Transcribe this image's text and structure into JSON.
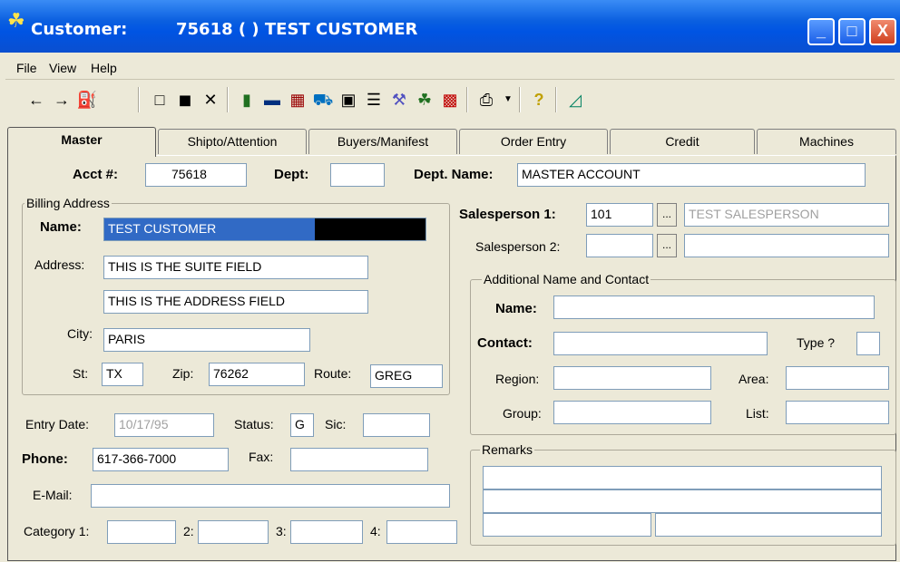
{
  "window": {
    "title": "Customer:",
    "title_acct": "75618 (   ) TEST CUSTOMER",
    "minimize_glyph": "_",
    "maximize_glyph": "□",
    "close_glyph": "X"
  },
  "menu": {
    "file": "File",
    "view": "View",
    "help": "Help"
  },
  "toolbar": {
    "icons": [
      "back-arrow-icon",
      "forward-arrow-icon",
      "binoculars-icon",
      "new-document-icon",
      "save-disk-icon",
      "delete-x-icon",
      "book-icon",
      "ruler-icon",
      "calendar-icon",
      "truck-icon",
      "open-book-icon",
      "hierarchy-icon",
      "tools-icon",
      "handshake-icon",
      "report-icon",
      "print-icon",
      "dropdown-arrow-icon",
      "help-question-icon",
      "exit-door-icon"
    ]
  },
  "tabs": [
    {
      "label": "Master",
      "active": true
    },
    {
      "label": "Shipto/Attention",
      "active": false
    },
    {
      "label": "Buyers/Manifest",
      "active": false
    },
    {
      "label": "Order Entry",
      "active": false
    },
    {
      "label": "Credit",
      "active": false
    },
    {
      "label": "Machines",
      "active": false
    }
  ],
  "form": {
    "acct_label": "Acct #:",
    "acct_value": "75618",
    "dept_label": "Dept:",
    "dept_value": "",
    "dept_name_label": "Dept. Name:",
    "dept_name_value": "MASTER ACCOUNT",
    "billing": {
      "legend": "Billing Address",
      "name_label": "Name:",
      "name_value": "TEST CUSTOMER",
      "address_label": "Address:",
      "address1": "THIS IS THE SUITE FIELD",
      "address2": "THIS IS THE ADDRESS FIELD",
      "city_label": "City:",
      "city_value": "PARIS",
      "st_label": "St:",
      "st_value": "TX",
      "zip_label": "Zip:",
      "zip_value": "76262",
      "route_label": "Route:",
      "route_value": "GREG"
    },
    "entry_date_label": "Entry Date:",
    "entry_date_value": "10/17/95",
    "status_label": "Status:",
    "status_value": "G",
    "sic_label": "Sic:",
    "sic_value": "",
    "phone_label": "Phone:",
    "phone_value": "617-366-7000",
    "fax_label": "Fax:",
    "fax_value": "",
    "email_label": "E-Mail:",
    "email_value": "",
    "category1_label": "Category 1:",
    "category2_label": "2:",
    "category3_label": "3:",
    "category4_label": "4:",
    "salesperson1_label": "Salesperson 1:",
    "salesperson1_code": "101",
    "salesperson1_name": "TEST SALESPERSON",
    "salesperson2_label": "Salesperson 2:",
    "salesperson2_code": "",
    "salesperson2_name": "",
    "lookup_label": "...",
    "additional": {
      "legend": "Additional Name and Contact",
      "name_label": "Name:",
      "name_value": "",
      "contact_label": "Contact:",
      "contact_value": "",
      "type_label": "Type ?",
      "type_value": "",
      "region_label": "Region:",
      "region_value": "",
      "area_label": "Area:",
      "area_value": "",
      "group_label": "Group:",
      "group_value": "",
      "list_label": "List:",
      "list_value": ""
    },
    "remarks": {
      "legend": "Remarks"
    }
  }
}
